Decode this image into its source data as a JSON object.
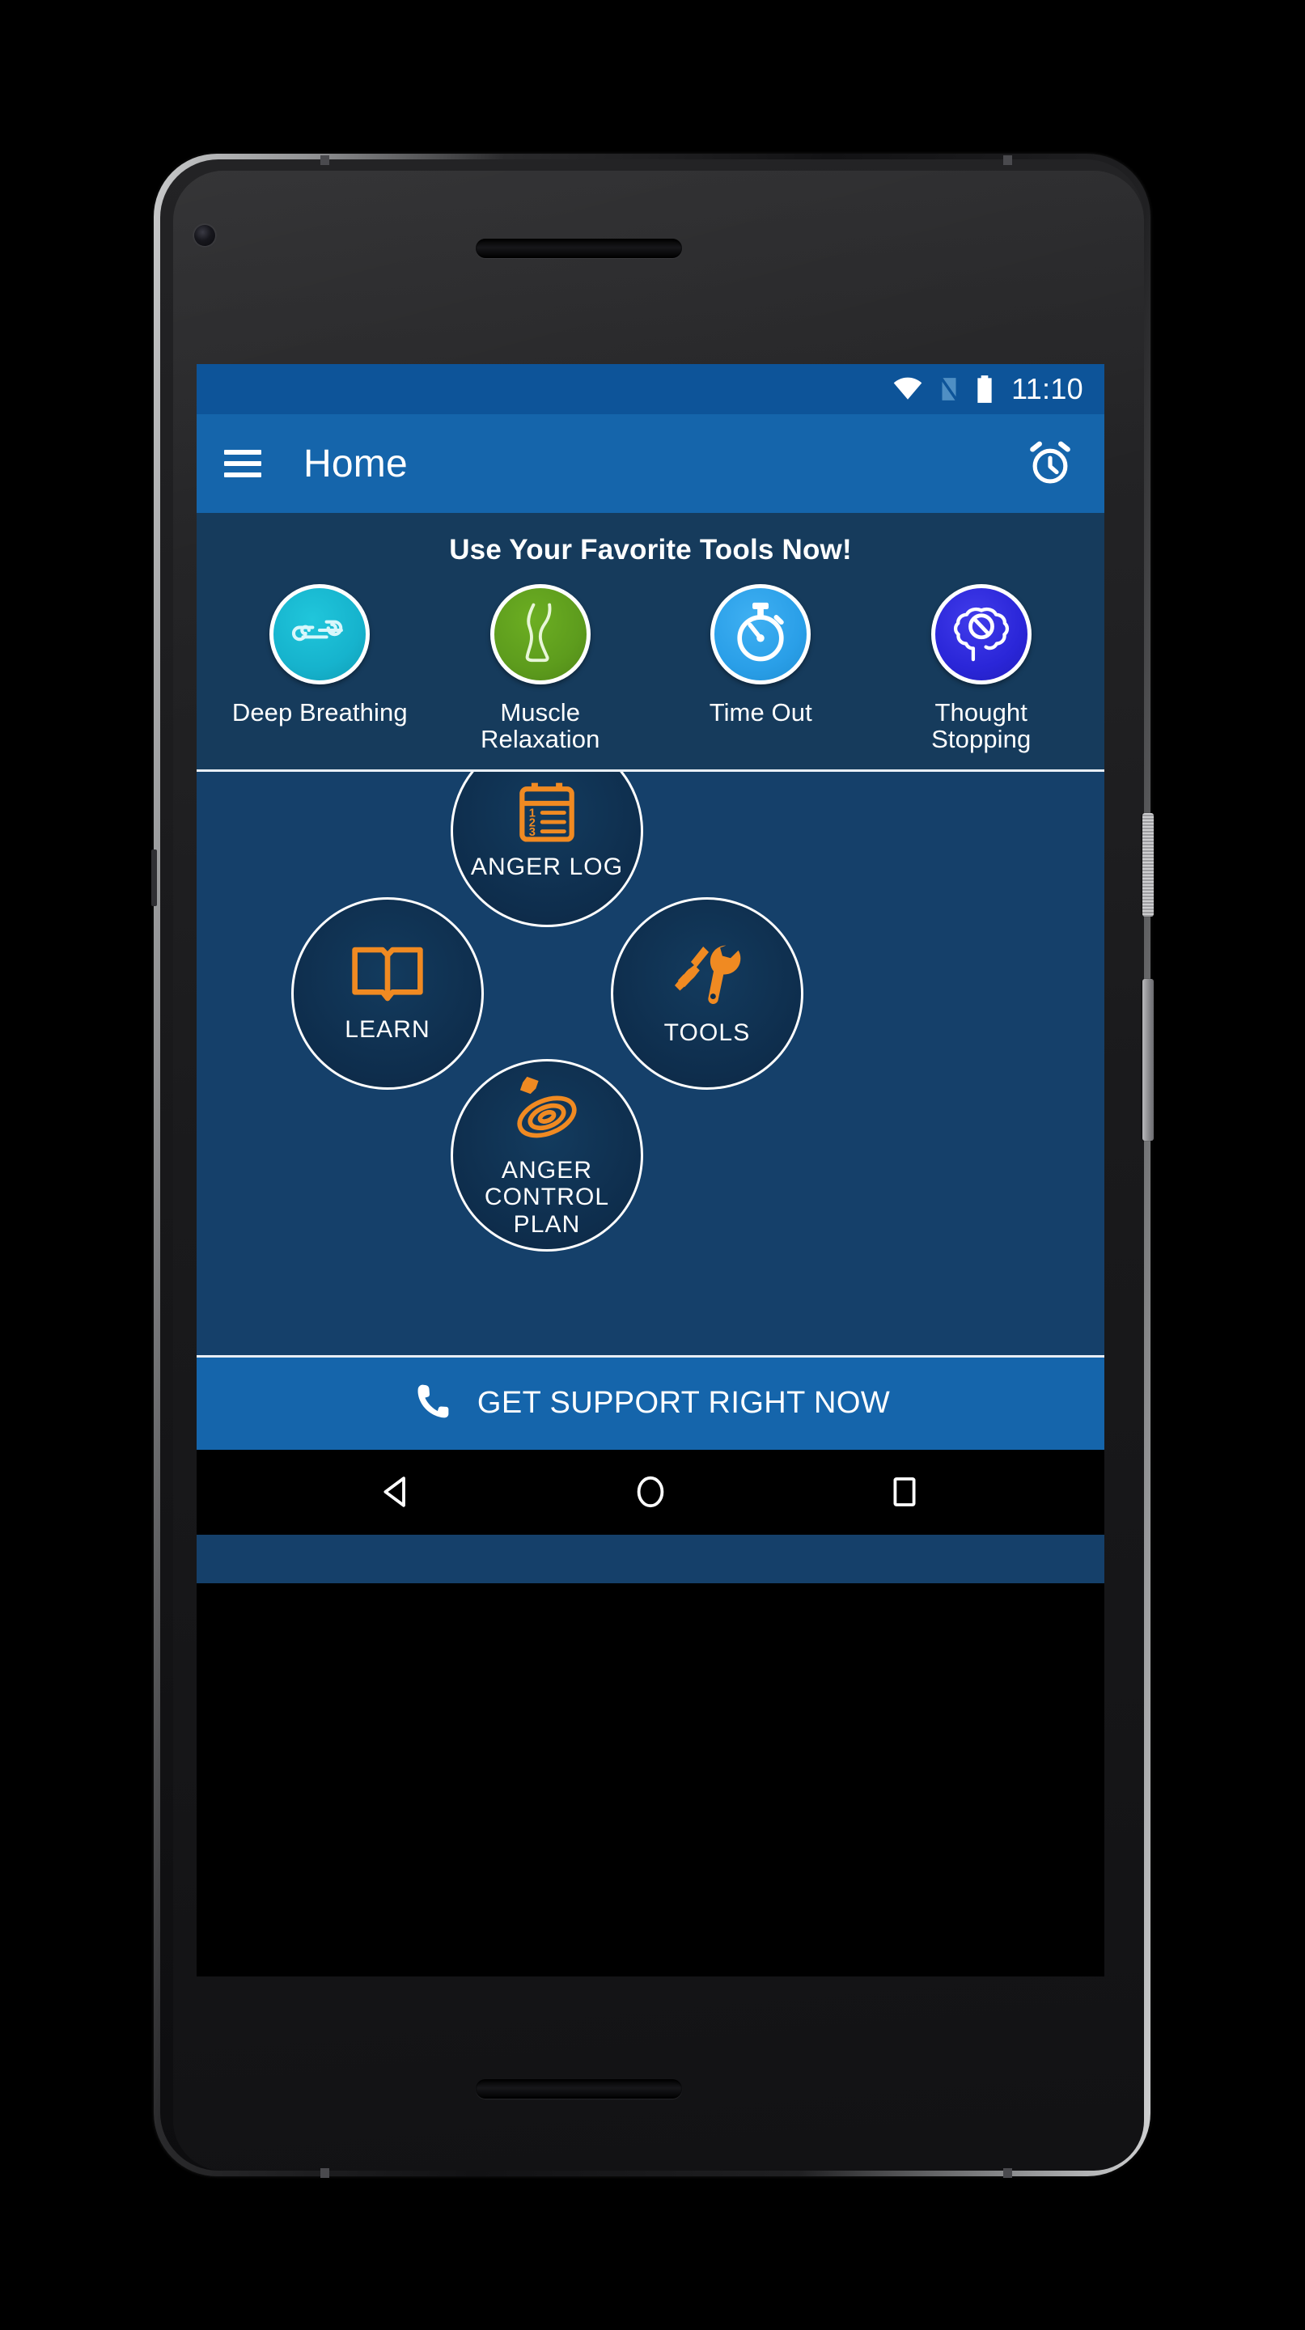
{
  "device": {
    "type": "android-phone-mockup",
    "camera_icon": "front-camera",
    "earpiece_icon": "earpiece-speaker",
    "bottom_speaker_icon": "bottom-speaker",
    "power_button": "power-button",
    "volume_button": "volume-rocker"
  },
  "status_bar": {
    "wifi_icon": "wifi-icon",
    "signal_icon": "no-sim-signal-icon",
    "battery_icon": "battery-full-icon",
    "time": "11:10",
    "background": "#0d5499"
  },
  "app_bar": {
    "menu_icon": "hamburger-menu-icon",
    "title": "Home",
    "action_icon": "alarm-clock-icon",
    "background": "#1565ab"
  },
  "favorites": {
    "title": "Use Your Favorite Tools Now!",
    "background": "#163b5c",
    "items": [
      {
        "label": "Deep Breathing",
        "icon": "wind-breathing-icon",
        "color": "#16b3cd"
      },
      {
        "label": "Muscle Relaxation",
        "icon": "leg-muscle-icon",
        "color": "#5d9c1d"
      },
      {
        "label": "Time Out",
        "icon": "stopwatch-icon",
        "color": "#2a9fe8"
      },
      {
        "label": "Thought Stopping",
        "icon": "brain-no-entry-icon",
        "color": "#2a26d8"
      }
    ]
  },
  "main_menu": {
    "background": "#15406a",
    "accent": "#f08a22",
    "items": [
      {
        "label": "ANGER LOG",
        "icon": "clipboard-numbered-list-icon",
        "position": "top"
      },
      {
        "label": "LEARN",
        "icon": "open-book-icon",
        "position": "left"
      },
      {
        "label": "TOOLS",
        "icon": "screwdriver-wrench-icon",
        "position": "right"
      },
      {
        "label": "ANGER CONTROL PLAN",
        "icon": "spiral-target-arrow-icon",
        "position": "bottom"
      }
    ]
  },
  "support_bar": {
    "icon": "phone-call-icon",
    "label": "GET SUPPORT RIGHT NOW",
    "background": "#1565ab"
  },
  "nav_bar": {
    "back_icon": "back-triangle-icon",
    "home_icon": "home-circle-icon",
    "recents_icon": "recents-square-icon",
    "background": "#000000"
  }
}
